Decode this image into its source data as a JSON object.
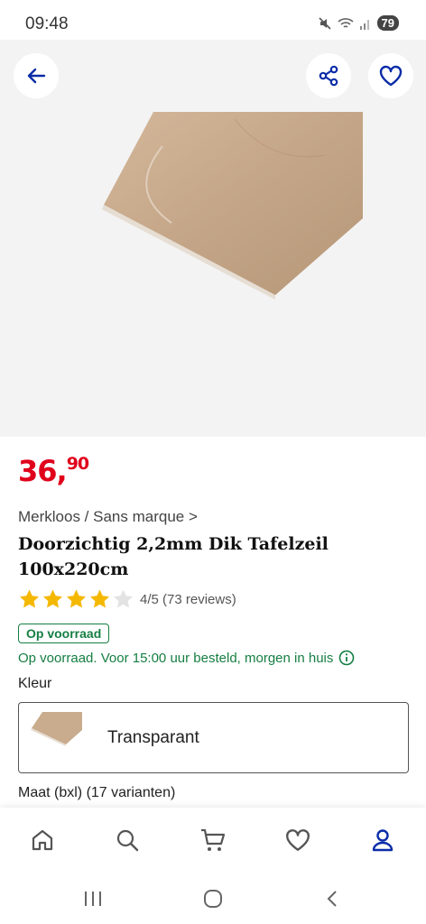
{
  "status_bar": {
    "time": "09:48",
    "battery": "79",
    "icons": [
      "mute-icon",
      "wifi-icon",
      "signal-icon"
    ]
  },
  "header": {
    "back_icon": "back-arrow-icon",
    "share_icon": "share-icon",
    "favorite_icon": "heart-icon"
  },
  "product": {
    "price_whole": "36,",
    "price_cents": "90",
    "brand_breadcrumb": "Merkloos / Sans marque >",
    "title": "Doorzichtig 2,2mm Dik Tafelzeil 100x220cm",
    "rating_value": 4,
    "rating_max": 5,
    "rating_text": "4/5 (73 reviews)",
    "stock_badge": "Op voorraad",
    "delivery_text": "Op voorraad. Voor 15:00 uur besteld, morgen in huis",
    "color_label": "Kleur",
    "selected_color": "Transparant",
    "size_label": "Maat (bxl) (17 varianten)"
  },
  "bottom_nav": {
    "items": [
      "home-icon",
      "search-icon",
      "cart-icon",
      "heart-icon",
      "account-icon"
    ],
    "active": "account-icon"
  },
  "colors": {
    "price": "#e0001b",
    "accent": "#0a2ca8",
    "stock": "#157e42",
    "star": "#f5b800"
  }
}
